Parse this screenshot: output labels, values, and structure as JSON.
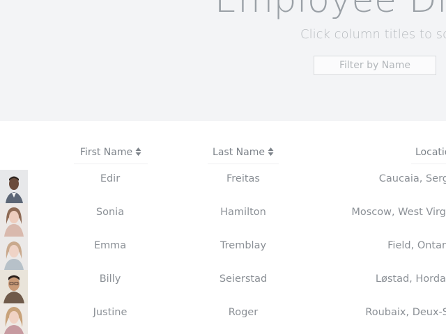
{
  "header": {
    "title": "Employee Dire",
    "subtitle": "Click column titles to sort",
    "filter_placeholder": "Filter by Name"
  },
  "table": {
    "columns": {
      "first_name": "First Name",
      "last_name": "Last Name",
      "location": "Locatio"
    },
    "rows": [
      {
        "first": "Edir",
        "last": "Freitas",
        "location": "Caucaia, Serg"
      },
      {
        "first": "Sonia",
        "last": "Hamilton",
        "location": "Moscow, West Virgi"
      },
      {
        "first": "Emma",
        "last": "Tremblay",
        "location": "Field, Ontari"
      },
      {
        "first": "Billy",
        "last": "Seierstad",
        "location": "Løstad, Hordal"
      },
      {
        "first": "Justine",
        "last": "Roger",
        "location": "Roubaix, Deux-S"
      }
    ]
  },
  "icons": {
    "sort": "sort-icon",
    "avatar": "avatar-photo"
  },
  "colors": {
    "header_bg": "#f3f4f6",
    "text": "#8b9096"
  }
}
